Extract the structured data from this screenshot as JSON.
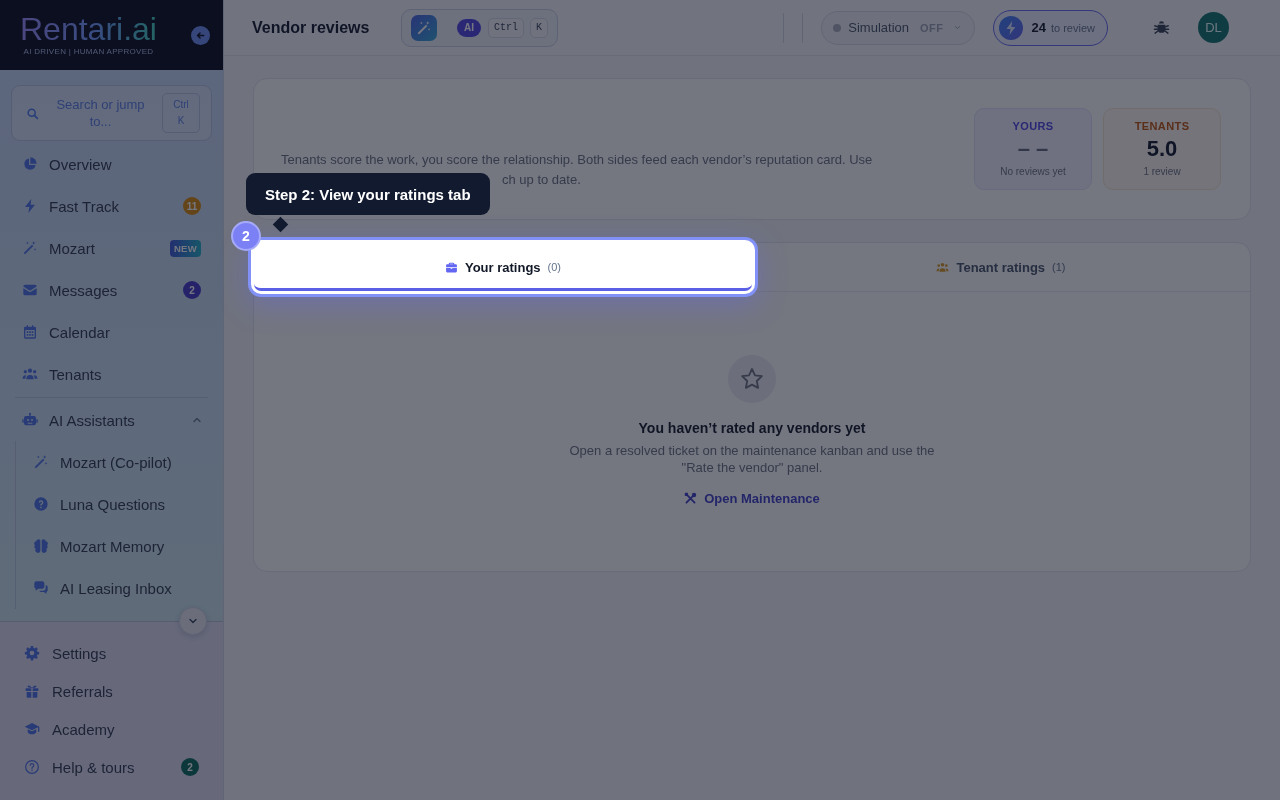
{
  "sidebar": {
    "logo": {
      "name": "Rentari.ai",
      "tagline": "AI DRIVEN | HUMAN APPROVED"
    },
    "search": {
      "placeholder": "Search or jump to...",
      "shortcut": "Ctrl K"
    },
    "items": [
      {
        "kind": "link",
        "label": "Overview",
        "selected": false
      },
      {
        "kind": "link",
        "label": "Fast Track",
        "selected": false,
        "badge": {
          "kind": "warning",
          "text": "11"
        }
      },
      {
        "kind": "link",
        "label": "Mozart",
        "selected": false,
        "badge": {
          "kind": "new",
          "text": "NEW"
        }
      },
      {
        "kind": "link",
        "label": "Messages",
        "selected": false,
        "badge": {
          "kind": "info",
          "text": "2"
        }
      },
      {
        "kind": "link",
        "label": "Calendar",
        "selected": false
      },
      {
        "kind": "link",
        "label": "Tenants",
        "selected": false
      },
      {
        "kind": "group",
        "label": "AI Assistants",
        "expanded": true,
        "children": [
          {
            "label": "Mozart (Co-pilot)",
            "selected": false
          },
          {
            "label": "Luna Questions",
            "selected": false
          },
          {
            "label": "Mozart Memory",
            "selected": false
          },
          {
            "label": "AI Leasing Inbox",
            "selected": false
          }
        ]
      }
    ],
    "footer_items": [
      {
        "label": "Settings",
        "selected": false
      },
      {
        "label": "Referrals",
        "selected": false
      },
      {
        "label": "Academy",
        "selected": false
      },
      {
        "label": "Help & tours",
        "selected": false,
        "badge": {
          "kind": "success",
          "text": "2"
        }
      }
    ]
  },
  "topbar": {
    "title": "Vendor reviews",
    "command": {
      "badge": "AI",
      "keys": [
        "Ctrl",
        "K"
      ]
    },
    "simulation": {
      "label": "Simulation",
      "state": "OFF",
      "on": false
    },
    "review": {
      "count": "24",
      "label": "to review"
    },
    "avatar": {
      "initials": "DL"
    }
  },
  "summary": {
    "description_lines": [
      "Tenants score the work, you score the relationship. Both sides feed each vendor’s reputation card. Use",
      "ch up to date."
    ],
    "stats": [
      {
        "kind": "yours",
        "label": "YOURS",
        "value": "– –",
        "note": "No reviews yet"
      },
      {
        "kind": "tenants",
        "label": "TENANTS",
        "value": "5.0",
        "note": "1 review"
      }
    ]
  },
  "tabs": [
    {
      "label": "Your ratings",
      "count": "(0)",
      "selected": true,
      "highlighted": true
    },
    {
      "label": "Tenant ratings",
      "count": "(1)",
      "selected": false,
      "highlighted": false
    }
  ],
  "empty_state": {
    "title": "You haven’t rated any vendors yet",
    "text": "Open a resolved ticket on the maintenance kanban and use the \"Rate the vendor\" panel.",
    "link": "Open Maintenance"
  },
  "tour": {
    "step": "2",
    "title": "Step 2: View your ratings tab"
  }
}
